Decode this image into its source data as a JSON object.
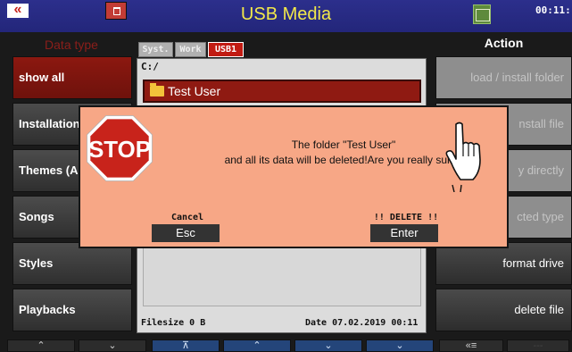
{
  "titlebar": {
    "back_glyph": "«",
    "title": "USB Media",
    "clock": "00:11:"
  },
  "left_panel": {
    "header": "Data type",
    "items": [
      {
        "label": "show all",
        "active": true
      },
      {
        "label": "Installation",
        "active": false
      },
      {
        "label": "Themes (A",
        "active": false
      },
      {
        "label": "Songs",
        "active": false
      },
      {
        "label": "Styles",
        "active": false
      },
      {
        "label": "Playbacks",
        "active": false
      }
    ]
  },
  "tabs": [
    {
      "label": "Syst.",
      "selected": false
    },
    {
      "label": "Work",
      "selected": false
    },
    {
      "label": "USB1",
      "selected": true
    }
  ],
  "file_panel": {
    "path": "C:/",
    "selected_folder": "Test User",
    "filesize": "Filesize 0 B",
    "date": "Date 07.02.2019  00:11"
  },
  "right_panel": {
    "header": "Action",
    "items": [
      {
        "label": "load / install folder",
        "dim": true
      },
      {
        "label": "nstall file",
        "dim": true
      },
      {
        "label": "y directly",
        "dim": true
      },
      {
        "label": "cted type",
        "dim": true
      },
      {
        "label": "format drive",
        "dim": false
      },
      {
        "label": "delete file",
        "dim": false
      }
    ]
  },
  "bottom_bar": [
    {
      "icon": "scroll-up-icon",
      "glyph": "⌃"
    },
    {
      "icon": "scroll-down-icon",
      "glyph": "⌄"
    },
    {
      "icon": "page-top-icon",
      "glyph": "⊼"
    },
    {
      "icon": "page-up-icon",
      "glyph": "⌃"
    },
    {
      "icon": "page-down-icon",
      "glyph": "⌄"
    },
    {
      "icon": "expand-icon",
      "glyph": "⌄"
    },
    {
      "icon": "collapse-list-icon",
      "glyph": "«≡"
    },
    {
      "icon": "blank-icon",
      "glyph": "---"
    }
  ],
  "dialog": {
    "stop_text": "STOP",
    "message_line1": "The folder \"Test User\"",
    "message_line2": "and all its data will be deleted!Are you really sure?",
    "cancel_label": "Cancel",
    "cancel_key": "Esc",
    "confirm_label": "!! DELETE !!",
    "confirm_key": "Enter"
  },
  "colors": {
    "title_bar": "#23267a",
    "title_text": "#f2e84a",
    "active_item": "#8c1810",
    "dialog_bg": "#f7a786",
    "stop_red": "#c8231b"
  }
}
